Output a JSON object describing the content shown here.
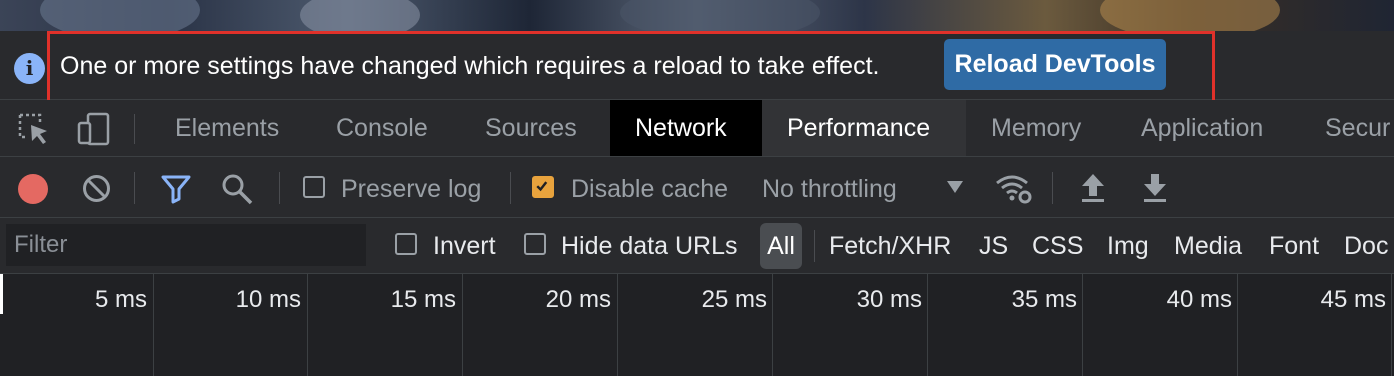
{
  "infobar": {
    "message": "One or more settings have changed which requires a reload to take effect.",
    "reload_label": "Reload DevTools",
    "icon": "info-icon",
    "highlight_color": "#e0312a"
  },
  "tabs": [
    {
      "label": "Elements"
    },
    {
      "label": "Console"
    },
    {
      "label": "Sources"
    },
    {
      "label": "Network"
    },
    {
      "label": "Performance"
    },
    {
      "label": "Memory"
    },
    {
      "label": "Application"
    },
    {
      "label": "Secur"
    }
  ],
  "active_tab": "Network",
  "toolbar": {
    "preserve_log_label": "Preserve log",
    "preserve_log_checked": false,
    "disable_cache_label": "Disable cache",
    "disable_cache_checked": true,
    "throttling_value": "No throttling",
    "record_color": "#e46962",
    "filter_icon_color": "#8ab4f8"
  },
  "filter": {
    "placeholder": "Filter",
    "invert_label": "Invert",
    "hide_data_urls_label": "Hide data URLs",
    "types": [
      "All",
      "Fetch/XHR",
      "JS",
      "CSS",
      "Img",
      "Media",
      "Font",
      "Doc"
    ],
    "selected_type": "All"
  },
  "timeline": {
    "ticks": [
      "5 ms",
      "10 ms",
      "15 ms",
      "20 ms",
      "25 ms",
      "30 ms",
      "35 ms",
      "40 ms",
      "45 ms"
    ]
  }
}
